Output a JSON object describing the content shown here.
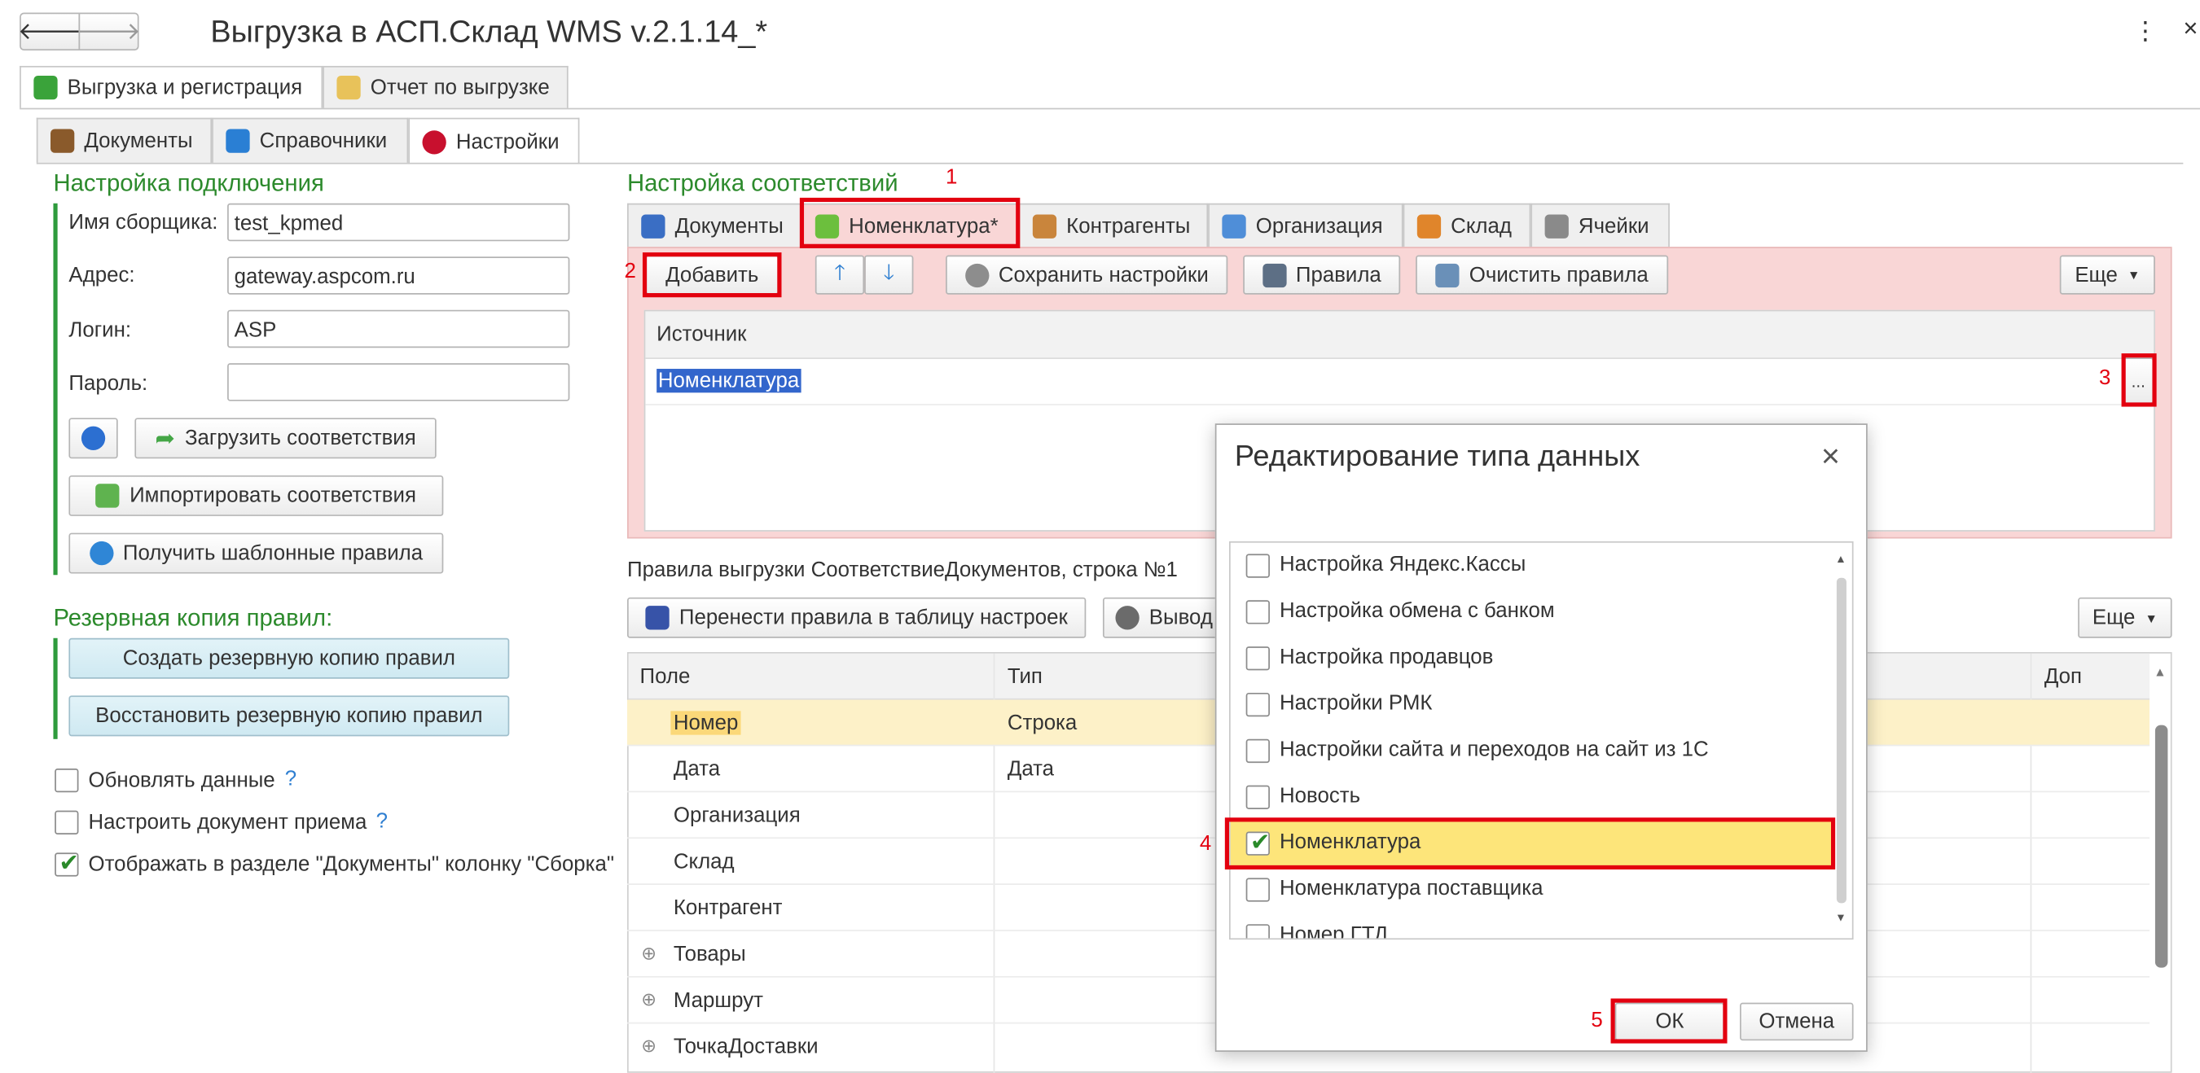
{
  "window": {
    "title": "Выгрузка в АСП.Склад WMS v.2.1.14_*"
  },
  "main_tabs": [
    {
      "label": "Выгрузка и регистрация"
    },
    {
      "label": "Отчет по выгрузке"
    }
  ],
  "sub_tabs": [
    {
      "label": "Документы"
    },
    {
      "label": "Справочники"
    },
    {
      "label": "Настройки"
    }
  ],
  "connection": {
    "title": "Настройка подключения",
    "collector_label": "Имя сборщика:",
    "collector_value": "test_kpmed",
    "address_label": "Адрес:",
    "address_value": "gateway.aspcom.ru",
    "login_label": "Логин:",
    "login_value": "ASP",
    "password_label": "Пароль:",
    "password_value": "",
    "load_btn": "Загрузить соответствия",
    "import_btn": "Импортировать соответствия",
    "templates_btn": "Получить шаблонные правила"
  },
  "backup": {
    "title": "Резервная копия правил:",
    "create_btn": "Создать резервную копию правил",
    "restore_btn": "Восстановить резервную копию правил"
  },
  "options": [
    {
      "label": "Обновлять данные",
      "help": "?",
      "checked": false
    },
    {
      "label": "Настроить документ приема",
      "help": "?",
      "checked": false
    },
    {
      "label": "Отображать в разделе \"Документы\" колонку \"Сборка\"",
      "help": "",
      "checked": true
    }
  ],
  "mapping": {
    "title": "Настройка соответствий",
    "tabs": [
      {
        "label": "Документы"
      },
      {
        "label": "Номенклатура*"
      },
      {
        "label": "Контрагенты"
      },
      {
        "label": "Организация"
      },
      {
        "label": "Склад"
      },
      {
        "label": "Ячейки"
      }
    ],
    "toolbar": {
      "add": "Добавить",
      "save": "Сохранить настройки",
      "rules": "Правила",
      "clear": "Очистить правила",
      "more": "Еще"
    },
    "source_header": "Источник",
    "source_value": "Номенклатура",
    "ellipsis": "..."
  },
  "rules": {
    "caption": "Правила выгрузки СоответствиеДокументов, строка №1",
    "move_btn": "Перенести правила в таблицу настроек",
    "output_btn": "Вывод",
    "more": "Еще",
    "columns": {
      "field": "Поле",
      "type": "Тип",
      "extra": "Доп"
    },
    "rows": [
      {
        "field": "Номер",
        "type": "Строка",
        "expand": ""
      },
      {
        "field": "Дата",
        "type": "Дата",
        "expand": ""
      },
      {
        "field": "Организация",
        "type": "",
        "expand": ""
      },
      {
        "field": "Склад",
        "type": "",
        "expand": ""
      },
      {
        "field": "Контрагент",
        "type": "",
        "expand": ""
      },
      {
        "field": "Товары",
        "type": "",
        "expand": "⊕"
      },
      {
        "field": "Маршрут",
        "type": "",
        "expand": "⊕"
      },
      {
        "field": "ТочкаДоставки",
        "type": "",
        "expand": "⊕"
      }
    ]
  },
  "dialog": {
    "title": "Редактирование типа данных",
    "close": "×",
    "items": [
      {
        "label": "Настройка Яндекс.Кассы",
        "checked": false
      },
      {
        "label": "Настройка обмена с банком",
        "checked": false
      },
      {
        "label": "Настройка продавцов",
        "checked": false
      },
      {
        "label": "Настройки РМК",
        "checked": false
      },
      {
        "label": "Настройки сайта и переходов на сайт из 1С",
        "checked": false
      },
      {
        "label": "Новость",
        "checked": false
      },
      {
        "label": "Номенклатура",
        "checked": true
      },
      {
        "label": "Номенклатура поставщика",
        "checked": false
      },
      {
        "label": "Номер ГТД",
        "checked": false
      }
    ],
    "ok": "ОК",
    "cancel": "Отмена"
  },
  "annotations": [
    "1",
    "2",
    "3",
    "4",
    "5"
  ],
  "nav": {
    "back": "🡐",
    "forward": "🡒",
    "menu": "⋮",
    "close": "×"
  },
  "colors": {
    "accent_green": "#2c8a2c",
    "highlight_red": "#e3000f",
    "selection_yellow": "#fde57a",
    "pink_panel": "#f9d6d6"
  }
}
